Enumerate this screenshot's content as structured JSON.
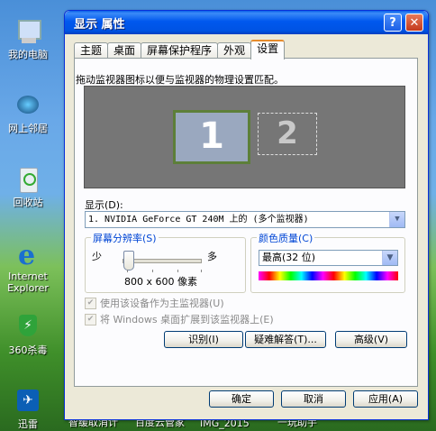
{
  "desktop": {
    "icons": [
      {
        "label": "我的电脑",
        "icon": "my-computer-icon"
      },
      {
        "label": "网上邻居",
        "icon": "network-places-icon"
      },
      {
        "label": "回收站",
        "icon": "recycle-bin-icon"
      },
      {
        "label": "Internet Explorer",
        "icon": "internet-explorer-icon"
      },
      {
        "label": "360杀毒",
        "icon": "360-antivirus-icon"
      },
      {
        "label": "迅雷",
        "icon": "thunder-icon"
      }
    ],
    "taskbar_labels": [
      "智缓取消计",
      "百度云管家",
      "IMG_2015",
      "一玩助手"
    ]
  },
  "window": {
    "title": "显示 属性",
    "help_symbol": "?",
    "close_symbol": "✕",
    "tabs": [
      "主题",
      "桌面",
      "屏幕保护程序",
      "外观",
      "设置"
    ],
    "active_tab": "设置",
    "instruction": "拖动监视器图标以便与监视器的物理设置匹配。",
    "monitors": [
      "1",
      "2"
    ],
    "display_label": "显示(D):",
    "display_value": "1. NVIDIA GeForce GT 240M  上的 (多个监视器)",
    "resolution": {
      "group_label": "屏幕分辨率(S)",
      "less": "少",
      "more": "多",
      "value_text": "800 x 600 像素",
      "slider_position": 0
    },
    "color_quality": {
      "group_label": "颜色质量(C)",
      "value": "最高(32 位)"
    },
    "checkboxes": [
      {
        "label": "使用该设备作为主监视器(U)",
        "checked": true
      },
      {
        "label": "将 Windows 桌面扩展到该监视器上(E)",
        "checked": true
      }
    ],
    "buttons": {
      "identify": "识别(I)",
      "troubleshoot": "疑难解答(T)...",
      "advanced": "高级(V)",
      "ok": "确定",
      "cancel": "取消",
      "apply": "应用(A)"
    }
  }
}
